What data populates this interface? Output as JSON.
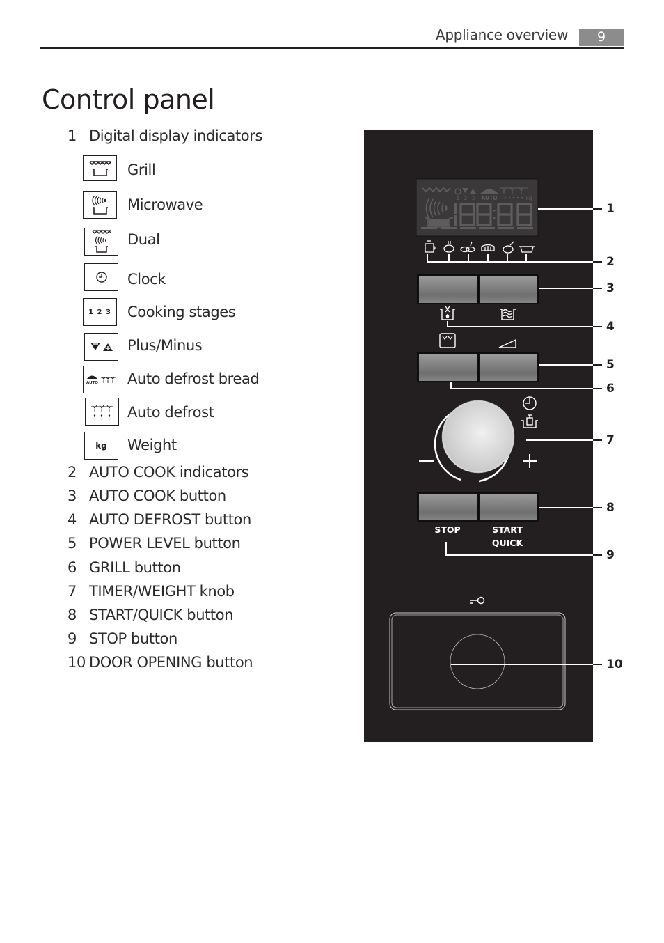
{
  "header": {
    "section_title": "Appliance overview",
    "page_number": "9"
  },
  "page_title": "Control panel",
  "legend": {
    "item1": {
      "num": "1",
      "label": "Digital display indicators"
    },
    "indicators": [
      {
        "icon": "grill-icon",
        "label": "Grill"
      },
      {
        "icon": "microwave-icon",
        "label": "Microwave"
      },
      {
        "icon": "dual-icon",
        "label": "Dual"
      },
      {
        "icon": "clock-icon",
        "label": "Clock"
      },
      {
        "icon": "cooking-stages-icon",
        "label": "Cooking stages",
        "icon_text": "1 2 3"
      },
      {
        "icon": "plus-minus-icon",
        "label": "Plus/Minus"
      },
      {
        "icon": "auto-defrost-bread-icon",
        "label": "Auto defrost bread",
        "icon_text": "AUTO"
      },
      {
        "icon": "auto-defrost-icon",
        "label": "Auto defrost"
      },
      {
        "icon": "weight-icon",
        "label": "Weight",
        "icon_text": "kg"
      }
    ],
    "items": [
      {
        "num": "2",
        "label": "AUTO COOK indicators"
      },
      {
        "num": "3",
        "label": "AUTO COOK button"
      },
      {
        "num": "4",
        "label": "AUTO DEFROST button"
      },
      {
        "num": "5",
        "label": "POWER LEVEL button"
      },
      {
        "num": "6",
        "label": "GRILL button"
      },
      {
        "num": "7",
        "label": "TIMER/WEIGHT knob"
      },
      {
        "num": "8",
        "label": "START/QUICK button"
      },
      {
        "num": "9",
        "label": "STOP button"
      },
      {
        "num": "10",
        "label": "DOOR OPENING button"
      }
    ]
  },
  "panel": {
    "display": {
      "digits": "88:88",
      "stage_numbers": "1  2  3",
      "auto_text": "AUTO",
      "kg_text": "kg"
    },
    "stop_label": "STOP",
    "start_label": "START",
    "quick_label": "QUICK",
    "callouts": [
      "1",
      "2",
      "3",
      "4",
      "5",
      "6",
      "7",
      "8",
      "9",
      "10"
    ]
  },
  "colors": {
    "panel_bg": "#231f20",
    "page_badge": "#8c8c8c",
    "text": "#231f20"
  }
}
